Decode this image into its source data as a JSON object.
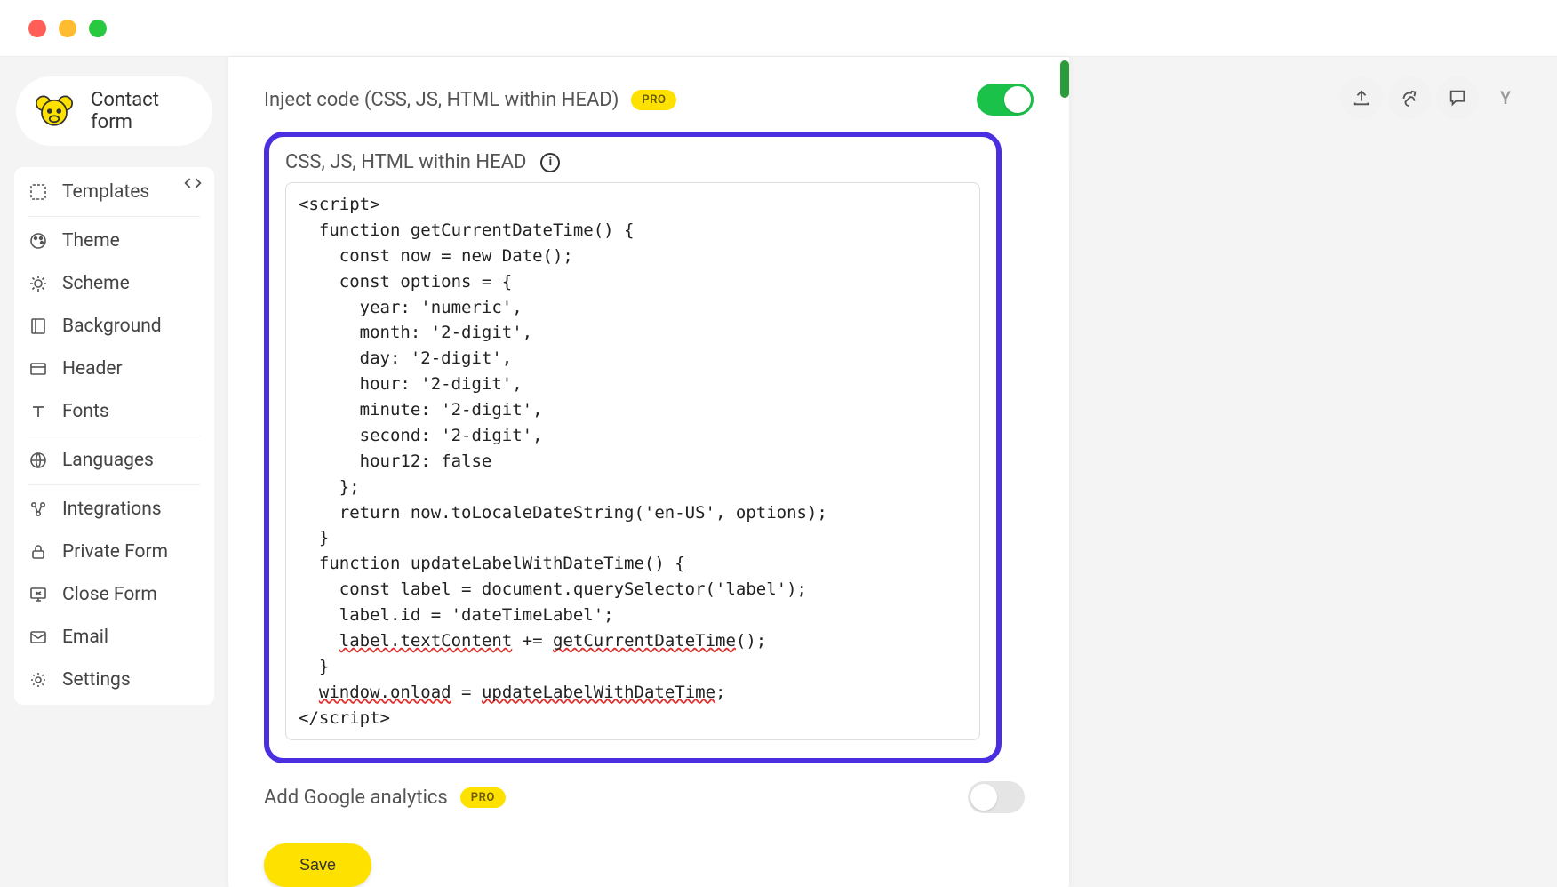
{
  "window": {
    "title": "Contact form"
  },
  "sidebar": {
    "items": [
      {
        "id": "templates",
        "label": "Templates"
      },
      {
        "id": "theme",
        "label": "Theme"
      },
      {
        "id": "scheme",
        "label": "Scheme"
      },
      {
        "id": "background",
        "label": "Background"
      },
      {
        "id": "header",
        "label": "Header"
      },
      {
        "id": "fonts",
        "label": "Fonts"
      },
      {
        "id": "languages",
        "label": "Languages"
      },
      {
        "id": "integrations",
        "label": "Integrations"
      },
      {
        "id": "private-form",
        "label": "Private Form"
      },
      {
        "id": "close-form",
        "label": "Close Form"
      },
      {
        "id": "email",
        "label": "Email"
      },
      {
        "id": "settings",
        "label": "Settings"
      }
    ]
  },
  "panel": {
    "inject": {
      "title": "Inject code (CSS, JS, HTML within HEAD)",
      "badge": "PRO",
      "enabled": true,
      "field_label": "CSS, JS, HTML within HEAD",
      "code_lines": [
        "<script>",
        "  function getCurrentDateTime() {",
        "    const now = new Date();",
        "    const options = {",
        "      year: 'numeric',",
        "      month: '2-digit',",
        "      day: '2-digit',",
        "      hour: '2-digit',",
        "      minute: '2-digit',",
        "      second: '2-digit',",
        "      hour12: false",
        "    };",
        "    return now.toLocaleDateString('en-US', options);",
        "  }",
        "  function updateLabelWithDateTime() {",
        "    const label = document.querySelector('label');",
        "    label.id = 'dateTimeLabel';",
        "    label.textContent += getCurrentDateTime();",
        "  }",
        "  window.onload = updateLabelWithDateTime;",
        "</script>"
      ],
      "spellcheck_underlined": [
        "label.textContent",
        "getCurrentDateTime",
        "window.onload",
        "updateLabelWithDateTime"
      ]
    },
    "analytics": {
      "title": "Add Google analytics",
      "badge": "PRO",
      "enabled": false
    },
    "save_label": "Save"
  },
  "right_tools": {
    "avatar_letter": "Y"
  }
}
